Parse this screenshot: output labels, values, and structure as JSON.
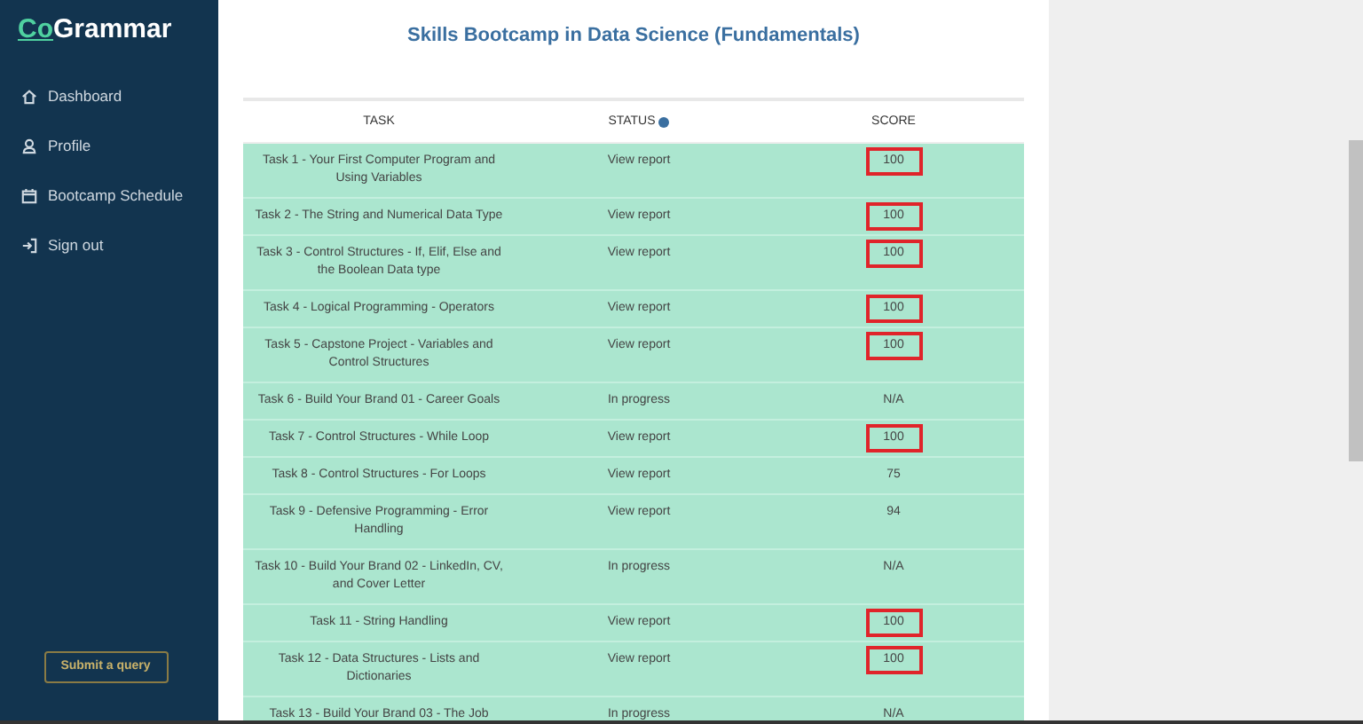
{
  "logo": {
    "accent": "Co",
    "rest": "Grammar"
  },
  "sidebar": {
    "items": [
      {
        "label": "Dashboard",
        "kind": "home"
      },
      {
        "label": "Profile",
        "kind": "user"
      },
      {
        "label": "Bootcamp Schedule",
        "kind": "calendar"
      },
      {
        "label": "Sign out",
        "kind": "signout"
      }
    ],
    "button": "Submit a query"
  },
  "title": "Skills Bootcamp in Data Science (Fundamentals)",
  "table": {
    "columns": [
      {
        "label": "TASK"
      },
      {
        "label": "STATUS",
        "info": true
      },
      {
        "label": "SCORE"
      }
    ],
    "rows": [
      {
        "task": "Task 1 - Your First Computer Program and Using Variables",
        "status": "View report",
        "score": "100",
        "highlighted": true
      },
      {
        "task": "Task 2 - The String and Numerical Data Type",
        "status": "View report",
        "score": "100",
        "highlighted": true
      },
      {
        "task": "Task 3 - Control Structures - If, Elif, Else and the Boolean Data type",
        "status": "View report",
        "score": "100",
        "highlighted": true
      },
      {
        "task": "Task 4 - Logical Programming - Operators",
        "status": "View report",
        "score": "100",
        "highlighted": true
      },
      {
        "task": "Task 5 - Capstone Project - Variables and Control Structures",
        "status": "View report",
        "score": "100",
        "highlighted": true
      },
      {
        "task": "Task 6 - Build Your Brand 01 - Career Goals",
        "status": "In progress",
        "score": "N/A",
        "highlighted": false
      },
      {
        "task": "Task 7 - Control Structures - While Loop",
        "status": "View report",
        "score": "100",
        "highlighted": true
      },
      {
        "task": "Task 8 - Control Structures - For Loops",
        "status": "View report",
        "score": "75",
        "highlighted": false
      },
      {
        "task": "Task 9 - Defensive Programming - Error Handling",
        "status": "View report",
        "score": "94",
        "highlighted": false
      },
      {
        "task": "Task 10 - Build Your Brand 02 - LinkedIn, CV, and Cover Letter",
        "status": "In progress",
        "score": "N/A",
        "highlighted": false
      },
      {
        "task": "Task 11 - String Handling",
        "status": "View report",
        "score": "100",
        "highlighted": true
      },
      {
        "task": "Task 12 - Data Structures - Lists and Dictionaries",
        "status": "View report",
        "score": "100",
        "highlighted": true
      },
      {
        "task": "Task 13 - Build Your Brand 03 - The Job",
        "status": "In progress",
        "score": "N/A",
        "highlighted": false
      }
    ]
  }
}
